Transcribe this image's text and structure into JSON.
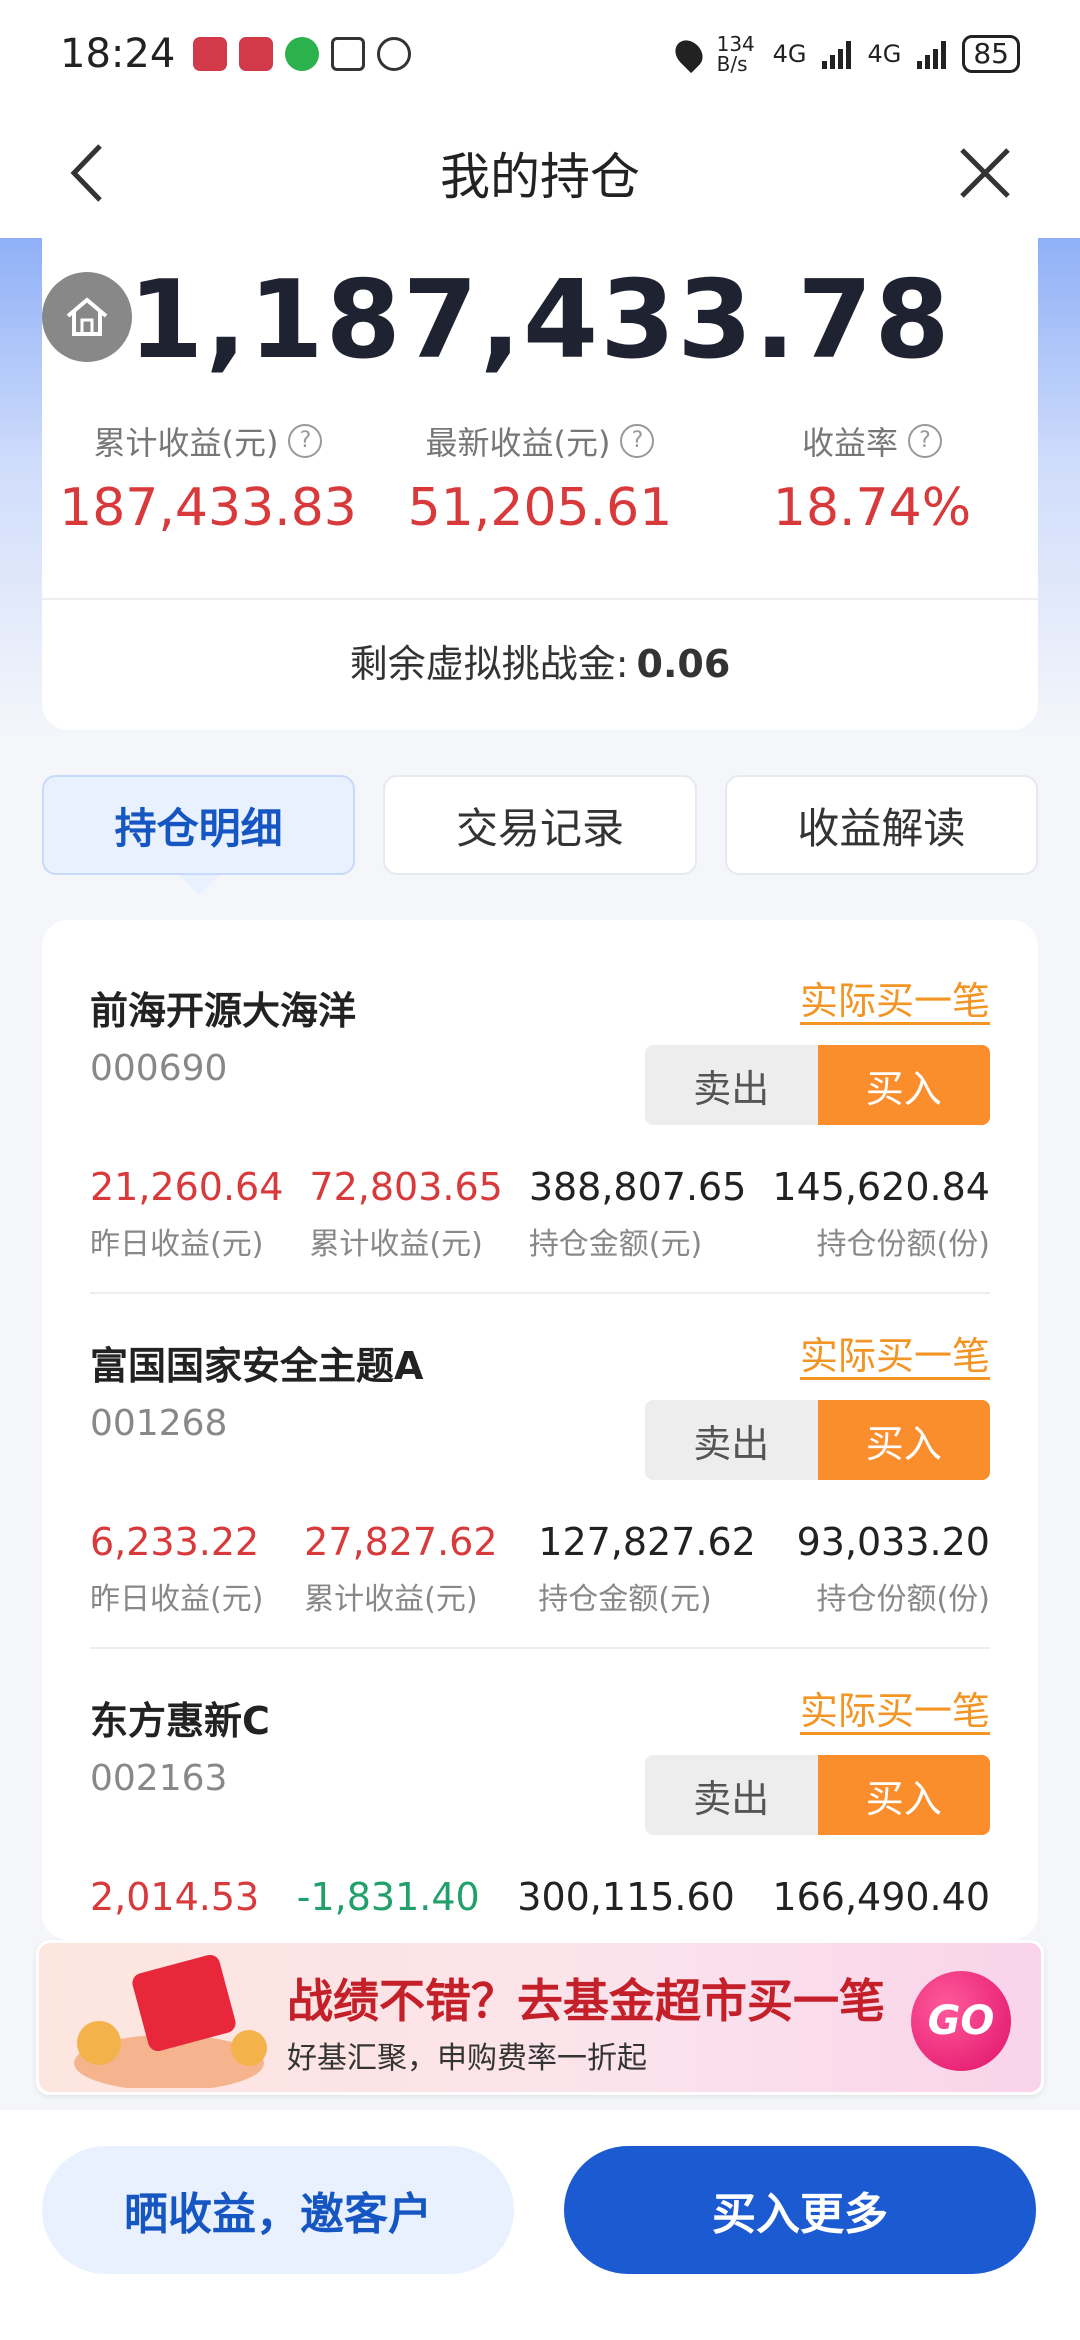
{
  "statusbar": {
    "time": "18:24",
    "net_speed": "134 B/s",
    "net_type": "4G",
    "battery": "85"
  },
  "header": {
    "title": "我的持仓"
  },
  "summary": {
    "total": "1,187,433.78",
    "stats": [
      {
        "label": "累计收益(元)",
        "value": "187,433.83"
      },
      {
        "label": "最新收益(元)",
        "value": "51,205.61"
      },
      {
        "label": "收益率",
        "value": "18.74%"
      }
    ],
    "remain_label": "剩余虚拟挑战金:",
    "remain_value": "0.06"
  },
  "tabs": [
    {
      "label": "持仓明细",
      "active": true
    },
    {
      "label": "交易记录",
      "active": false
    },
    {
      "label": "收益解读",
      "active": false
    }
  ],
  "funds": [
    {
      "name": "前海开源大海洋",
      "code": "000690",
      "buy_one": "实际买一笔",
      "sell": "卖出",
      "buy": "买入",
      "metrics": [
        {
          "value": "21,260.64",
          "label": "昨日收益(元)"
        },
        {
          "value": "72,803.65",
          "label": "累计收益(元)"
        },
        {
          "value": "388,807.65",
          "label": "持仓金额(元)"
        },
        {
          "value": "145,620.84",
          "label": "持仓份额(份)"
        }
      ]
    },
    {
      "name": "富国国家安全主题A",
      "code": "001268",
      "buy_one": "实际买一笔",
      "sell": "卖出",
      "buy": "买入",
      "metrics": [
        {
          "value": "6,233.22",
          "label": "昨日收益(元)"
        },
        {
          "value": "27,827.62",
          "label": "累计收益(元)"
        },
        {
          "value": "127,827.62",
          "label": "持仓金额(元)"
        },
        {
          "value": "93,033.20",
          "label": "持仓份额(份)"
        }
      ]
    },
    {
      "name": "东方惠新C",
      "code": "002163",
      "buy_one": "实际买一笔",
      "sell": "卖出",
      "buy": "买入",
      "metrics": [
        {
          "value": "2,014.53",
          "label": ""
        },
        {
          "value": "-1,831.40",
          "label": ""
        },
        {
          "value": "300,115.60",
          "label": ""
        },
        {
          "value": "166,490.40",
          "label": ""
        }
      ]
    }
  ],
  "banner": {
    "title": "战绩不错？去基金超市买一笔",
    "subtitle": "好基汇聚，申购费率一折起",
    "go": "GO"
  },
  "bottom": {
    "share_label": "晒收益，邀客户",
    "buy_more_label": "买入更多"
  },
  "colors": {
    "primary": "#1c5ad1",
    "gain": "#d8393a",
    "loss": "#21a06b",
    "buy": "#fb8e2c"
  }
}
